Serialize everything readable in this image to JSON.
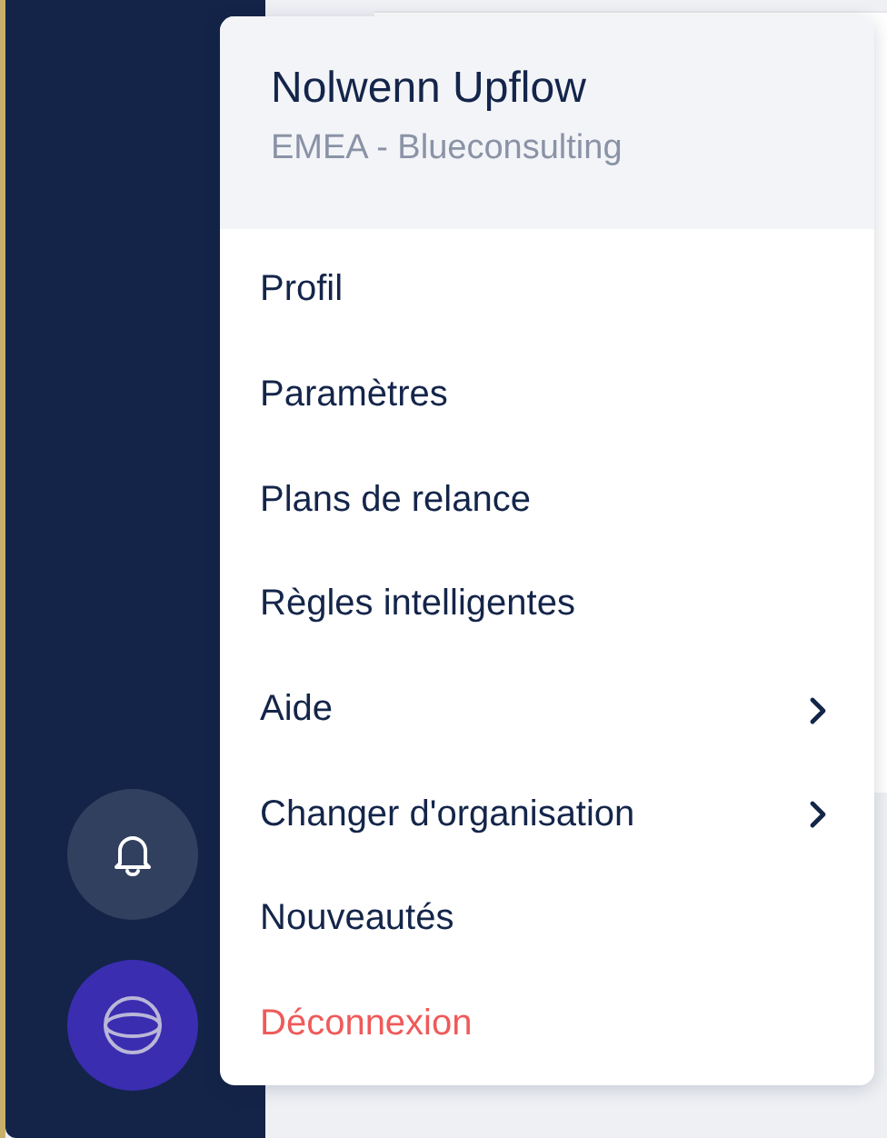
{
  "user_menu": {
    "name": "Nolwenn Upflow",
    "organization": "EMEA - Blueconsulting",
    "items": [
      {
        "label": "Profil",
        "kind": "link"
      },
      {
        "label": "Paramètres",
        "kind": "link"
      },
      {
        "label": "Plans de relance",
        "kind": "link"
      },
      {
        "label": "Règles intelligentes",
        "kind": "link"
      },
      {
        "label": "Aide",
        "kind": "submenu"
      },
      {
        "label": "Changer d'organisation",
        "kind": "submenu"
      },
      {
        "label": "Nouveautés",
        "kind": "link"
      },
      {
        "label": "Déconnexion",
        "kind": "danger"
      }
    ]
  }
}
